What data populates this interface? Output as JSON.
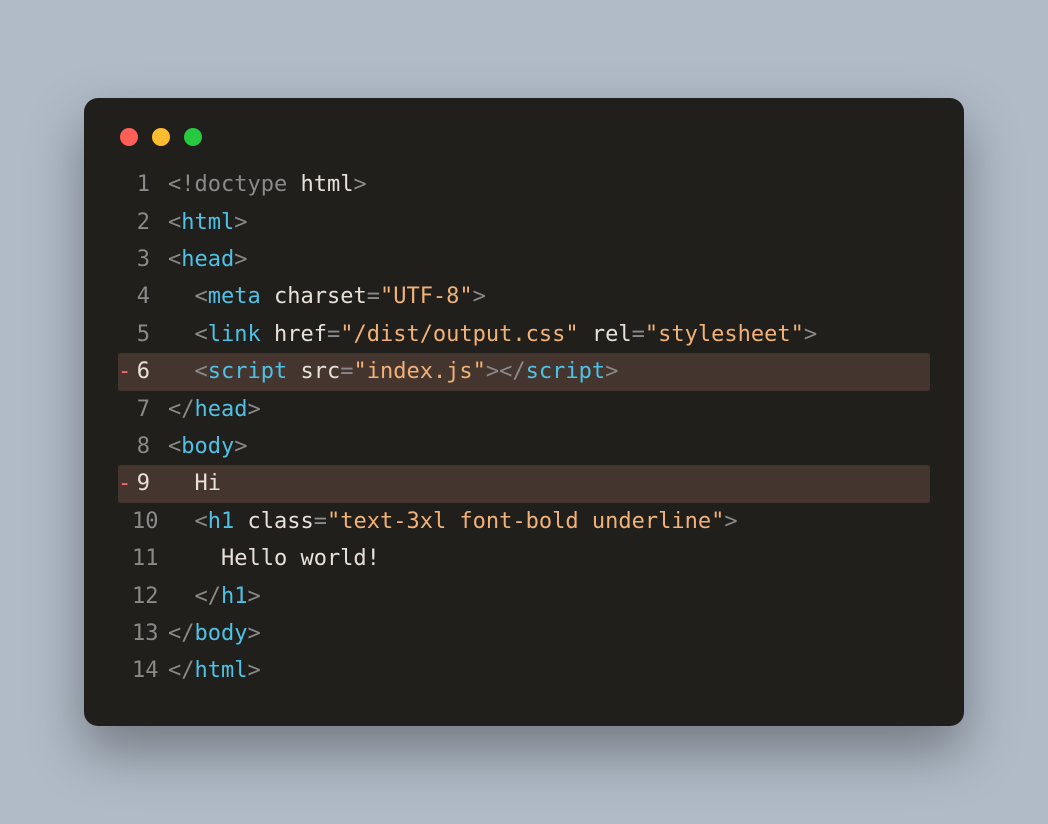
{
  "window": {
    "traffic": [
      "red",
      "yellow",
      "green"
    ]
  },
  "code": {
    "lines": [
      {
        "n": 1,
        "marker": "",
        "hl": false,
        "tokens": [
          [
            "p-punc",
            "<!"
          ],
          [
            "p-doctype",
            "doctype "
          ],
          [
            "p-doctype-arg",
            "html"
          ],
          [
            "p-punc",
            ">"
          ]
        ]
      },
      {
        "n": 2,
        "marker": "",
        "hl": false,
        "tokens": [
          [
            "p-punc",
            "<"
          ],
          [
            "p-tag",
            "html"
          ],
          [
            "p-punc",
            ">"
          ]
        ]
      },
      {
        "n": 3,
        "marker": "",
        "hl": false,
        "tokens": [
          [
            "p-punc",
            "<"
          ],
          [
            "p-tag",
            "head"
          ],
          [
            "p-punc",
            ">"
          ]
        ]
      },
      {
        "n": 4,
        "marker": "",
        "hl": false,
        "tokens": [
          [
            "p-text",
            "  "
          ],
          [
            "p-punc",
            "<"
          ],
          [
            "p-tag",
            "meta"
          ],
          [
            "p-attr",
            " charset"
          ],
          [
            "p-punc",
            "="
          ],
          [
            "p-str",
            "\"UTF-8\""
          ],
          [
            "p-punc",
            ">"
          ]
        ]
      },
      {
        "n": 5,
        "marker": "",
        "hl": false,
        "tokens": [
          [
            "p-text",
            "  "
          ],
          [
            "p-punc",
            "<"
          ],
          [
            "p-tag",
            "link"
          ],
          [
            "p-attr",
            " href"
          ],
          [
            "p-punc",
            "="
          ],
          [
            "p-str",
            "\"/dist/output.css\""
          ],
          [
            "p-attr",
            " rel"
          ],
          [
            "p-punc",
            "="
          ],
          [
            "p-str",
            "\"stylesheet\""
          ],
          [
            "p-punc",
            ">"
          ]
        ]
      },
      {
        "n": 6,
        "marker": "-",
        "hl": true,
        "tokens": [
          [
            "p-text",
            "  "
          ],
          [
            "p-punc",
            "<"
          ],
          [
            "p-tag",
            "script"
          ],
          [
            "p-attr",
            " src"
          ],
          [
            "p-punc",
            "="
          ],
          [
            "p-str",
            "\"index.js\""
          ],
          [
            "p-punc",
            "></"
          ],
          [
            "p-tag",
            "script"
          ],
          [
            "p-punc",
            ">"
          ]
        ]
      },
      {
        "n": 7,
        "marker": "",
        "hl": false,
        "tokens": [
          [
            "p-punc",
            "</"
          ],
          [
            "p-tag",
            "head"
          ],
          [
            "p-punc",
            ">"
          ]
        ]
      },
      {
        "n": 8,
        "marker": "",
        "hl": false,
        "tokens": [
          [
            "p-punc",
            "<"
          ],
          [
            "p-tag",
            "body"
          ],
          [
            "p-punc",
            ">"
          ]
        ]
      },
      {
        "n": 9,
        "marker": "-",
        "hl": true,
        "tokens": [
          [
            "p-text",
            "  Hi"
          ]
        ]
      },
      {
        "n": 10,
        "marker": "",
        "hl": false,
        "tokens": [
          [
            "p-text",
            "  "
          ],
          [
            "p-punc",
            "<"
          ],
          [
            "p-tag",
            "h1"
          ],
          [
            "p-attr",
            " class"
          ],
          [
            "p-punc",
            "="
          ],
          [
            "p-str",
            "\"text-3xl font-bold underline\""
          ],
          [
            "p-punc",
            ">"
          ]
        ]
      },
      {
        "n": 11,
        "marker": "",
        "hl": false,
        "tokens": [
          [
            "p-text",
            "    Hello world!"
          ]
        ]
      },
      {
        "n": 12,
        "marker": "",
        "hl": false,
        "tokens": [
          [
            "p-text",
            "  "
          ],
          [
            "p-punc",
            "</"
          ],
          [
            "p-tag",
            "h1"
          ],
          [
            "p-punc",
            ">"
          ]
        ]
      },
      {
        "n": 13,
        "marker": "",
        "hl": false,
        "tokens": [
          [
            "p-punc",
            "</"
          ],
          [
            "p-tag",
            "body"
          ],
          [
            "p-punc",
            ">"
          ]
        ]
      },
      {
        "n": 14,
        "marker": "",
        "hl": false,
        "tokens": [
          [
            "p-punc",
            "</"
          ],
          [
            "p-tag",
            "html"
          ],
          [
            "p-punc",
            ">"
          ]
        ]
      }
    ]
  }
}
